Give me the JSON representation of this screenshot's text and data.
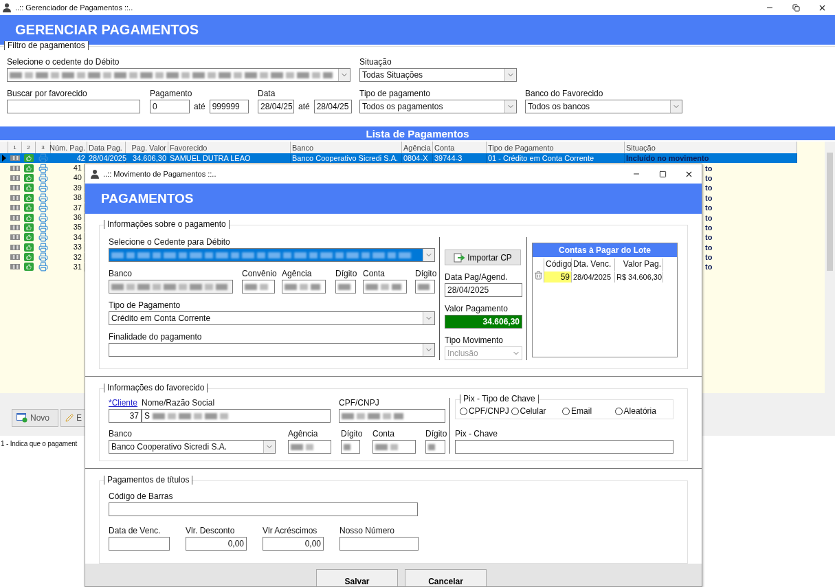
{
  "window": {
    "title": "..:: Gerenciador de Pagamentos ::.."
  },
  "header": {
    "title": "GERENCIAR PAGAMENTOS"
  },
  "filter": {
    "legend": "Filtro de pagamentos",
    "cedente": {
      "label": "Selecione o cedente do Débito"
    },
    "situacao": {
      "label": "Situação",
      "value": "Todas Situações"
    },
    "favorecido": {
      "label": "Buscar por favorecido"
    },
    "pagamento": {
      "label": "Pagamento",
      "from": "0",
      "sep": "até",
      "to": "999999"
    },
    "data": {
      "label": "Data",
      "from": "28/04/25",
      "sep": "até",
      "to": "28/04/25"
    },
    "tipo": {
      "label": "Tipo de pagamento",
      "value": "Todos os pagamentos"
    },
    "banco": {
      "label": "Banco do Favorecido",
      "value": "Todos os bancos"
    }
  },
  "list": {
    "title": "Lista de Pagamentos",
    "icon_columns": [
      "1",
      "2",
      "3"
    ],
    "columns": [
      "Núm. Pag.",
      "Data Pag.",
      "Pag. Valor",
      "Favorecido",
      "Banco",
      "Agência",
      "Conta",
      "Tipo de Pagamento",
      "Situação"
    ],
    "rows": [
      {
        "selected": true,
        "cells": [
          "42",
          "28/04/2025",
          "34.606,30",
          "SAMUEL DUTRA LEAO",
          "Banco Cooperativo Sicredi S.A.",
          "0804-X",
          "39744-3",
          "01 - Crédito em Conta Corrente",
          "Incluído no movimento"
        ]
      }
    ],
    "covered_rows": [
      {
        "num": "41",
        "tail": "to"
      },
      {
        "num": "40",
        "tail": "to"
      },
      {
        "num": "39",
        "tail": "to"
      },
      {
        "num": "38",
        "tail": "to"
      },
      {
        "num": "37",
        "tail": "to"
      },
      {
        "num": "36",
        "tail": "to"
      },
      {
        "num": "35",
        "tail": "to"
      },
      {
        "num": "34",
        "tail": "to"
      },
      {
        "num": "33",
        "tail": "to"
      },
      {
        "num": "32",
        "tail": "to"
      },
      {
        "num": "31",
        "tail": "to"
      }
    ]
  },
  "buttons": [
    "Novo",
    "E"
  ],
  "status_bar": "1 - Indica que o pagament",
  "dialog": {
    "title": "..:: Movimento de Pagamentos ::..",
    "header": "PAGAMENTOS",
    "pagamento": {
      "legend": "Informações sobre o pagamento",
      "cedente_label": "Selecione o Cedente para Débito",
      "banco_labels": [
        "Banco",
        "Convênio",
        "Agência",
        "Dígito",
        "Conta",
        "Dígito"
      ],
      "tipo": {
        "label": "Tipo de Pagamento",
        "value": "Crédito em Conta Corrente"
      },
      "finalidade": {
        "label": "Finalidade do pagamento"
      },
      "import_button": "Importar CP",
      "data": {
        "label": "Data Pag/Agend.",
        "value": "28/04/2025"
      },
      "valor": {
        "label": "Valor Pagamento",
        "value": "34.606,30"
      },
      "movimento": {
        "label": "Tipo Movimento",
        "value": "Inclusão",
        "disabled": true
      }
    },
    "contas": {
      "title": "Contas à Pagar do Lote",
      "columns": [
        "Código",
        "Dta. Venc.",
        "Valor Pag."
      ],
      "rows": [
        {
          "codigo": "59",
          "vencimento": "28/04/2025",
          "valor": "R$ 34.606,30"
        }
      ]
    },
    "favorecido": {
      "legend": "Informações do favorecido",
      "cliente_link": "*Cliente",
      "nome_label": "Nome/Razão Social",
      "cpf_label": "CPF/CNPJ",
      "cliente_code": "37",
      "nome_value": "S",
      "banco": {
        "label": "Banco",
        "value": "Banco Cooperativo Sicredi S.A."
      },
      "labels": [
        "Agência",
        "Dígito",
        "Conta",
        "Dígito"
      ]
    },
    "pix": {
      "legend": "Pix - Tipo de Chave",
      "options": [
        {
          "label": "CPF/CNPJ",
          "selected": false
        },
        {
          "label": "Celular",
          "selected": false
        },
        {
          "label": "Email",
          "selected": false
        },
        {
          "label": "Aleatória",
          "selected": false
        }
      ],
      "chave_label": "Pix - Chave"
    },
    "titulos": {
      "legend": "Pagamentos de títulos",
      "barcode_label": "Código de Barras",
      "fields": [
        {
          "label": "Data de Venc."
        },
        {
          "label": "Vlr. Desconto",
          "value": "0,00"
        },
        {
          "label": "Vlr Acréscimos",
          "value": "0,00"
        },
        {
          "label": "Nosso Número"
        }
      ]
    },
    "buttons": [
      "Salvar",
      "Cancelar"
    ]
  }
}
